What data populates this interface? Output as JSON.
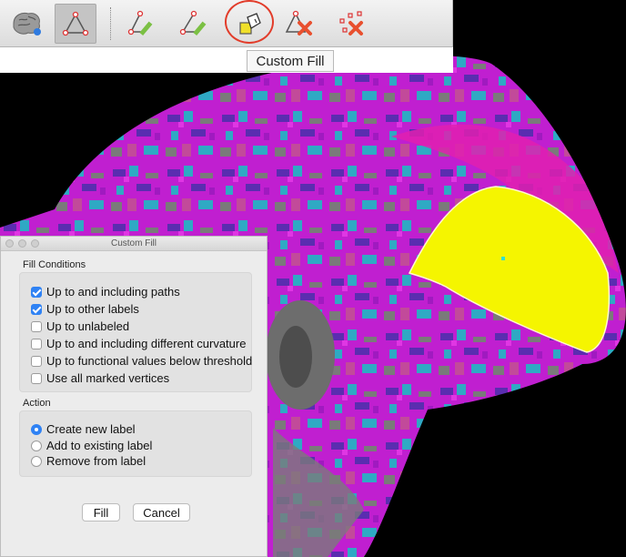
{
  "toolbar": {
    "buttons": [
      {
        "icon": "brain-icon"
      },
      {
        "icon": "triangle-path-icon"
      },
      {
        "icon": "edit-path-icon"
      },
      {
        "icon": "edit-path-alt-icon"
      },
      {
        "icon": "paint-bucket-icon"
      },
      {
        "icon": "delete-path-icon"
      },
      {
        "icon": "clear-marks-icon"
      }
    ],
    "tooltip": "Custom Fill",
    "colors": {
      "highlight_ring": "#e23c2a",
      "pencil": "#7bc043",
      "delete_x": "#e8502f"
    }
  },
  "dialog": {
    "title": "Custom Fill",
    "fill_conditions_label": "Fill Conditions",
    "fill_conditions": [
      {
        "label": "Up to and including paths",
        "checked": true
      },
      {
        "label": "Up to other labels",
        "checked": true
      },
      {
        "label": "Up to unlabeled",
        "checked": false
      },
      {
        "label": "Up to and including different curvature",
        "checked": false
      },
      {
        "label": "Up to functional values below threshold",
        "checked": false
      },
      {
        "label": "Use all marked vertices",
        "checked": false
      }
    ],
    "action_label": "Action",
    "actions": [
      {
        "label": "Create new label",
        "selected": true
      },
      {
        "label": "Add to existing label",
        "selected": false
      },
      {
        "label": "Remove from label",
        "selected": false
      }
    ],
    "fill_button": "Fill",
    "cancel_button": "Cancel"
  },
  "viewport": {
    "colors": {
      "background": "#000000",
      "surface_magenta": "#d21fd9",
      "surface_purple": "#6a2fb8",
      "surface_cyan": "#2fb4c9",
      "surface_gray": "#808080",
      "label_yellow": "#f5f500"
    }
  }
}
